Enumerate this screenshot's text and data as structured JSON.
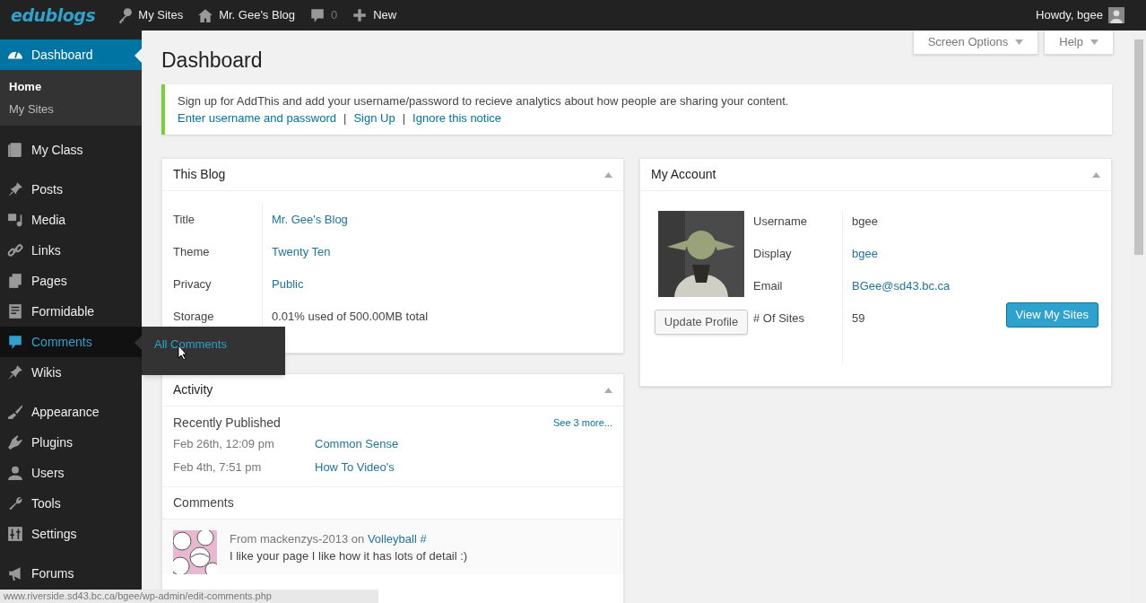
{
  "admin_bar": {
    "logo": "edublogs",
    "items": [
      {
        "kind": "key",
        "label": "My Sites"
      },
      {
        "kind": "home",
        "label": "Mr. Gee's Blog"
      },
      {
        "kind": "bubble",
        "label": "0"
      },
      {
        "kind": "plus",
        "label": "New"
      }
    ],
    "greeting": "Howdy, bgee"
  },
  "sidebar": {
    "groups": [
      [
        {
          "kind": "gauge",
          "label": "Dashboard",
          "selected": true,
          "hovered": false,
          "submenu": [
            {
              "label": "Home",
              "selected": true
            },
            {
              "label": "My Sites",
              "selected": false
            }
          ]
        }
      ],
      [
        {
          "kind": "book",
          "label": "My Class",
          "selected": false,
          "hovered": false
        }
      ],
      [
        {
          "kind": "pin",
          "label": "Posts",
          "selected": false,
          "hovered": false
        },
        {
          "kind": "media",
          "label": "Media",
          "selected": false,
          "hovered": false
        },
        {
          "kind": "link",
          "label": "Links",
          "selected": false,
          "hovered": false
        },
        {
          "kind": "pages",
          "label": "Pages",
          "selected": false,
          "hovered": false
        },
        {
          "kind": "form",
          "label": "Formidable",
          "selected": false,
          "hovered": false
        },
        {
          "kind": "bubble",
          "label": "Comments",
          "selected": false,
          "hovered": true,
          "flyout": [
            "All Comments"
          ]
        },
        {
          "kind": "pin",
          "label": "Wikis",
          "selected": false,
          "hovered": false
        }
      ],
      [
        {
          "kind": "brush",
          "label": "Appearance",
          "selected": false,
          "hovered": false
        },
        {
          "kind": "plug",
          "label": "Plugins",
          "selected": false,
          "hovered": false
        },
        {
          "kind": "user",
          "label": "Users",
          "selected": false,
          "hovered": false
        },
        {
          "kind": "wrench",
          "label": "Tools",
          "selected": false,
          "hovered": false
        },
        {
          "kind": "sliders",
          "label": "Settings",
          "selected": false,
          "hovered": false
        }
      ],
      [
        {
          "kind": "megaphone",
          "label": "Forums",
          "selected": false,
          "hovered": false
        }
      ]
    ]
  },
  "screen_meta": [
    "Screen Options",
    "Help"
  ],
  "page_title": "Dashboard",
  "notice": {
    "text": "Sign up for AddThis and add your username/password to recieve analytics about how people are sharing your content.",
    "links": [
      "Enter username and password",
      "Sign Up",
      "Ignore this notice"
    ],
    "separator": "|"
  },
  "this_blog": {
    "title": "This Blog",
    "rows": [
      {
        "label": "Title",
        "value": "Mr. Gee's Blog",
        "link": true
      },
      {
        "label": "Theme",
        "value": "Twenty Ten",
        "link": true
      },
      {
        "label": "Privacy",
        "value": "Public",
        "link": true
      },
      {
        "label": "Storage",
        "value": "0.01% used of 500.00MB total",
        "link": false
      }
    ]
  },
  "activity": {
    "title": "Activity",
    "recent_heading": "Recently Published",
    "see_more": "See 3 more...",
    "posts": [
      {
        "date": "Feb 26th, 12:09 pm",
        "title": "Common Sense"
      },
      {
        "date": "Feb 4th, 7:51 pm",
        "title": "How To Video's"
      }
    ],
    "comments_heading": "Comments",
    "comments": [
      {
        "prefix": "From mackenzys-2013 on",
        "post": "Volleyball #",
        "text": "I like your page I like how it has lots of detail :)"
      }
    ]
  },
  "my_account": {
    "title": "My Account",
    "update_button": "Update Profile",
    "rows": [
      {
        "label": "Username",
        "value": "bgee",
        "link": false
      },
      {
        "label": "Display",
        "value": "bgee",
        "link": true
      },
      {
        "label": "Email",
        "value": "BGee@sd43.bc.ca",
        "link": true
      },
      {
        "label": "# Of Sites",
        "value": "59",
        "link": false
      }
    ],
    "view_button": "View My Sites"
  },
  "status_bar": "www.riverside.sd43.bc.ca/bgee/wp-admin/edit-comments.php"
}
